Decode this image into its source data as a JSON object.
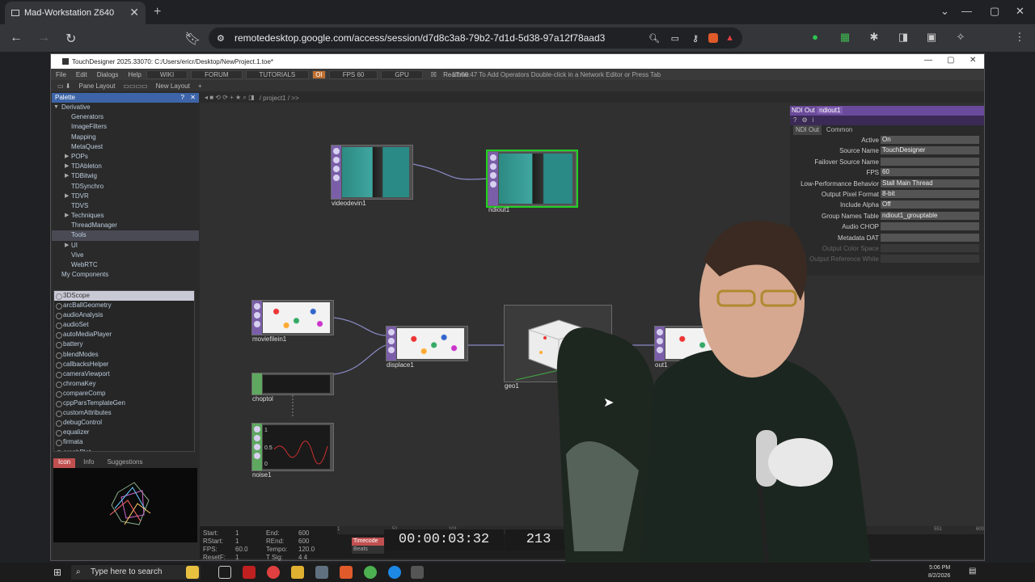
{
  "browser": {
    "tab_title": "Mad-Workstation Z640",
    "url": "remotedesktop.google.com/access/session/d7d8c3a8-79b2-7d1d-5d38-97a12f78aad3"
  },
  "td": {
    "title": "TouchDesigner 2025.33070: C:/Users/ericr/Desktop/NewProject.1.toe*",
    "menu": [
      "File",
      "Edit",
      "Dialogs",
      "Help"
    ],
    "menu_tabs": [
      "WIKI",
      "FORUM",
      "TUTORIALS",
      "OI",
      "FPS  60",
      "GPU",
      "Realtime"
    ],
    "status_message": "17:00:47 To Add Operators Double-click in a Network Editor or Press Tab",
    "layout_bar": [
      "Pane Layout",
      "New Layout"
    ],
    "path": "/ project1 / >>"
  },
  "palette": {
    "title": "Palette",
    "tree": [
      {
        "label": "Derivative",
        "arrow": "▼",
        "level": 0
      },
      {
        "label": "Generators",
        "level": 1
      },
      {
        "label": "ImageFilters",
        "level": 1
      },
      {
        "label": "Mapping",
        "level": 1
      },
      {
        "label": "MetaQuest",
        "level": 1
      },
      {
        "label": "POPs",
        "arrow": "▶",
        "level": 1
      },
      {
        "label": "TDAbleton",
        "arrow": "▶",
        "level": 1
      },
      {
        "label": "TDBitwig",
        "arrow": "▶",
        "level": 1
      },
      {
        "label": "TDSynchro",
        "level": 1
      },
      {
        "label": "TDVR",
        "arrow": "▶",
        "level": 1
      },
      {
        "label": "TDVS",
        "level": 1
      },
      {
        "label": "Techniques",
        "arrow": "▶",
        "level": 1
      },
      {
        "label": "ThreadManager",
        "level": 1
      },
      {
        "label": "Tools",
        "level": 1,
        "selected": true
      },
      {
        "label": "UI",
        "arrow": "▶",
        "level": 1
      },
      {
        "label": "Vive",
        "level": 1
      },
      {
        "label": "WebRTC",
        "level": 1
      },
      {
        "label": "My Components",
        "level": 0
      }
    ],
    "components": [
      "3DScope",
      "arcBallGeometry",
      "audioAnalysis",
      "audioSet",
      "autoMediaPlayer",
      "battery",
      "blendModes",
      "callbacksHelper",
      "cameraViewport",
      "chromaKey",
      "compareComp",
      "cppParsTemplateGen",
      "customAttributes",
      "debugControl",
      "equalizer",
      "firmata",
      "graphPlot"
    ],
    "preview_tabs": [
      "Icon",
      "Info",
      "Suggestions"
    ]
  },
  "nodes": [
    {
      "name": "videodevin1"
    },
    {
      "name": "ndiout1"
    },
    {
      "name": "moviefilein1"
    },
    {
      "name": "choptol"
    },
    {
      "name": "displace1"
    },
    {
      "name": "geo1"
    },
    {
      "name": "out1"
    },
    {
      "name": "noise1"
    }
  ],
  "noise_axis": [
    "1",
    "0.5",
    "0"
  ],
  "params": {
    "op_type": "NDI Out",
    "op_name": "ndiout1",
    "tabs": [
      "NDI Out",
      "Common"
    ],
    "rows": [
      {
        "label": "Active",
        "value": "On"
      },
      {
        "label": "Source Name",
        "value": "TouchDesigner"
      },
      {
        "label": "Failover Source Name",
        "value": ""
      },
      {
        "label": "FPS",
        "value": "60"
      },
      {
        "label": "Low-Performance Behavior",
        "value": "Stall Main Thread"
      },
      {
        "label": "Output Pixel Format",
        "value": "8-bit"
      },
      {
        "label": "Include Alpha",
        "value": "Off"
      },
      {
        "label": "Group Names Table",
        "value": "ndiout1_grouptable"
      },
      {
        "label": "Audio CHOP",
        "value": ""
      },
      {
        "label": "Metadata DAT",
        "value": ""
      },
      {
        "label": "Output Color Space",
        "value": ""
      },
      {
        "label": "Output Reference White",
        "value": ""
      }
    ]
  },
  "timeline": {
    "left": [
      [
        "Start:",
        "1"
      ],
      [
        "RStart:",
        "1"
      ],
      [
        "FPS:",
        "60.0"
      ],
      [
        "ResetF:",
        "1"
      ]
    ],
    "right": [
      [
        "End:",
        "600"
      ],
      [
        "REnd:",
        "600"
      ],
      [
        "Tempo:",
        "120.0"
      ],
      [
        "T Sig:",
        "4    4"
      ]
    ],
    "modes": [
      "Timecode",
      "Beats"
    ],
    "timecode": "00:00:03:32",
    "frame": "213",
    "ruler": [
      "1",
      "51",
      "101",
      "551",
      "600"
    ]
  },
  "taskbar": {
    "search": "Type here to search",
    "time": "5:06 PM",
    "date": "8/2/2026"
  }
}
